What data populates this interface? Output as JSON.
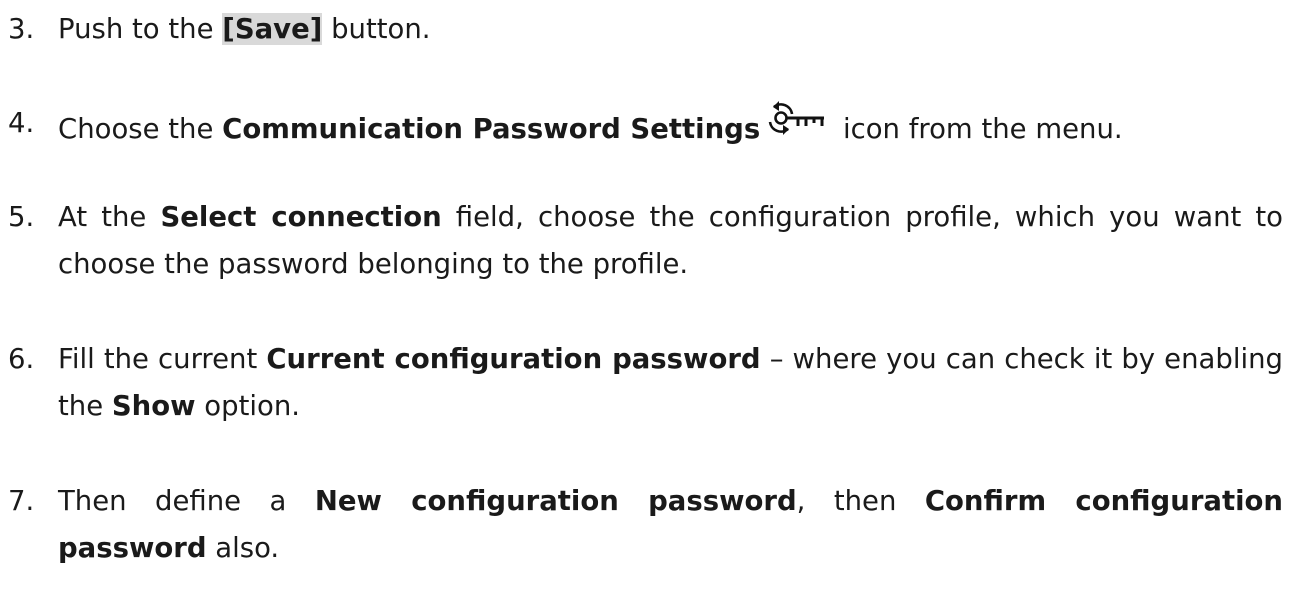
{
  "steps": [
    {
      "number": "3.",
      "parts": [
        "Push to the ",
        "[Save]",
        " button."
      ]
    },
    {
      "number": "4.",
      "parts": [
        "Choose the ",
        "Communication Password Settings",
        " icon from the menu."
      ],
      "icon": "key-refresh-icon"
    },
    {
      "number": "5.",
      "parts": [
        "At the ",
        "Select connection",
        " field, choose the configuration profile, which you want to choose the password belonging to the profile."
      ]
    },
    {
      "number": "6.",
      "parts": [
        "Fill the current ",
        "Current configuration password",
        " – where you can check it by enabling the ",
        "Show",
        " option."
      ]
    },
    {
      "number": "7.",
      "parts": [
        "Then define a ",
        "New configuration password",
        ", then ",
        "Confirm configuration password",
        " also."
      ]
    }
  ]
}
